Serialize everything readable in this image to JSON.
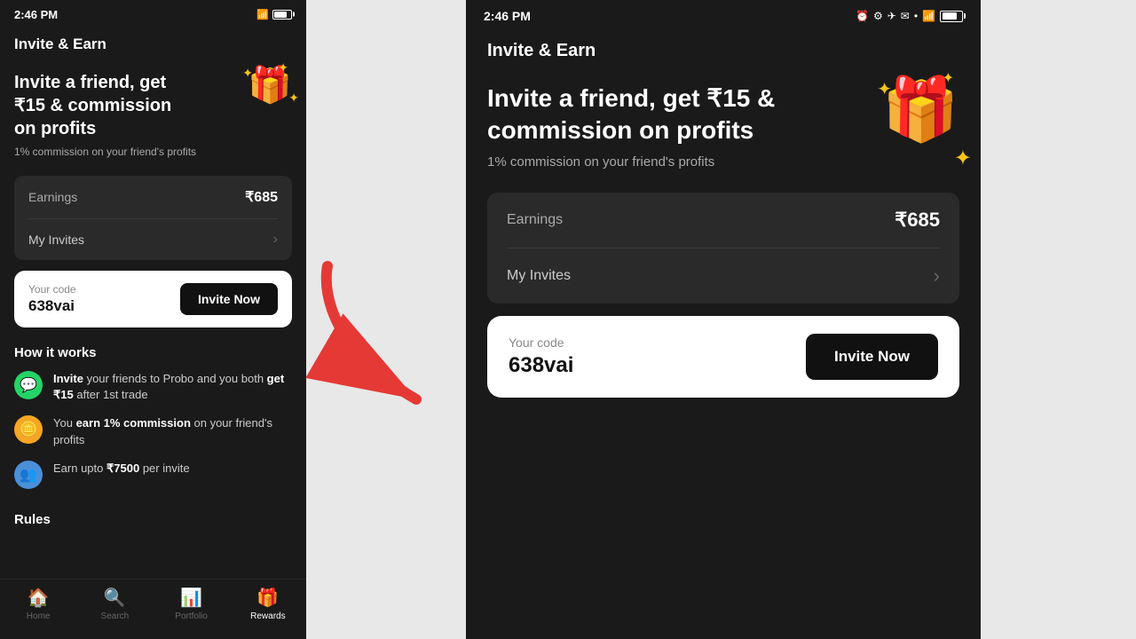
{
  "app": {
    "title": "Invite & Earn",
    "tagline": "Invite a friend, get ₹15 & commission on profits",
    "sub": "1% commission on your friend's profits",
    "earnings_label": "Earnings",
    "earnings_value": "₹685",
    "my_invites_label": "My Invites",
    "your_code_label": "Your code",
    "your_code_value": "638vai",
    "invite_now_label": "Invite Now",
    "how_it_works_title": "How it works",
    "rules_title": "Rules",
    "how_items": [
      {
        "icon": "💬",
        "icon_bg": "green",
        "text_html": "<strong>Invite</strong> your friends to Probo and you both <strong>get ₹15</strong> after 1st trade"
      },
      {
        "icon": "🪙",
        "icon_bg": "yellow",
        "text_html": "You <strong>earn 1% commission</strong> on your friend's profits"
      },
      {
        "icon": "👥",
        "icon_bg": "blue",
        "text_html": "Earn upto <strong>₹7500</strong> per invite"
      }
    ]
  },
  "status_bar_left": {
    "time": "2:46 PM"
  },
  "status_bar_right": {
    "time": "2:46 PM"
  },
  "bottom_nav": {
    "items": [
      {
        "label": "Home",
        "icon": "🏠",
        "active": false
      },
      {
        "label": "Search",
        "icon": "🔍",
        "active": false
      },
      {
        "label": "Portfolio",
        "icon": "📊",
        "active": false
      },
      {
        "label": "Rewards",
        "icon": "🎁",
        "active": true
      }
    ]
  }
}
